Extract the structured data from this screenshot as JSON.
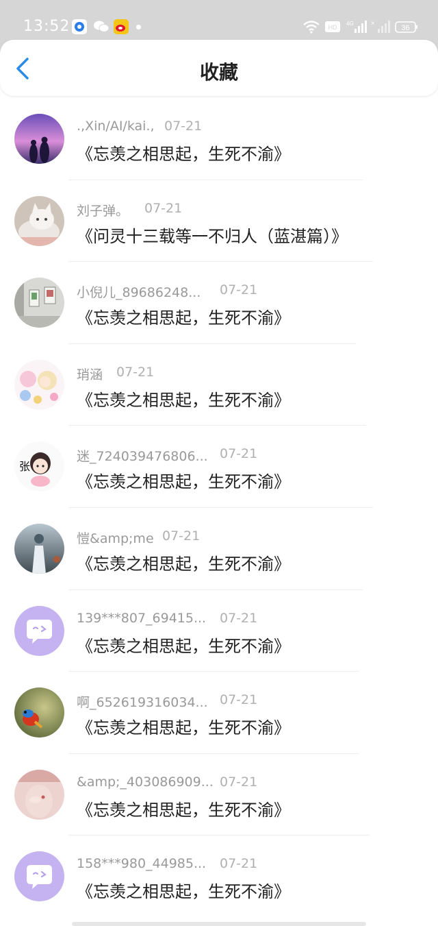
{
  "status_bar": {
    "time": "13:52",
    "network_label": "4G",
    "hd_label": "HD",
    "battery_level": "36",
    "notifications": [
      "qq-browser-icon",
      "wechat-icon",
      "weibo-icon"
    ]
  },
  "header": {
    "title": "收藏",
    "back_icon": "chevron-left-icon",
    "accent_color": "#2a8be6"
  },
  "items": [
    {
      "name": ".,Xin/AI/kai.,",
      "date": "07-21",
      "title": "《忘羡之相思起，生死不渝》",
      "avatar": "couple-sunset-purple"
    },
    {
      "name": "刘子弹。",
      "date": "07-21",
      "title": "《问灵十三载等一不归人（蓝湛篇）》",
      "avatar": "white-cat"
    },
    {
      "name": "小倪儿_89686248...",
      "date": "07-21",
      "title": "《忘羡之相思起，生死不渝》",
      "avatar": "gallery-wall"
    },
    {
      "name": "琑涵",
      "date": "07-21",
      "title": "《忘羡之相思起，生死不渝》",
      "avatar": "pastel-cartoon"
    },
    {
      "name": "迷_724039476806...",
      "date": "07-21",
      "title": "《忘羡之相思起，生死不渝》",
      "avatar": "cartoon-girl-zhang"
    },
    {
      "name": "愷&amp;me",
      "date": "07-21",
      "title": "《忘羡之相思起，生死不渝》",
      "avatar": "girl-back-sea"
    },
    {
      "name": "139***807_69415...",
      "date": "07-21",
      "title": "《忘羡之相思起，生死不渝》",
      "avatar": "default-chat-bubble"
    },
    {
      "name": "啊_652619316034...",
      "date": "07-21",
      "title": "《忘羡之相思起，生死不渝》",
      "avatar": "colorful-bird"
    },
    {
      "name": "&amp;_403086909...",
      "date": "07-21",
      "title": "《忘羡之相思起，生死不渝》",
      "avatar": "pink-hands"
    },
    {
      "name": "158***980_44985...",
      "date": "07-21",
      "title": "《忘羡之相思起，生死不渝》",
      "avatar": "default-chat-bubble"
    }
  ]
}
